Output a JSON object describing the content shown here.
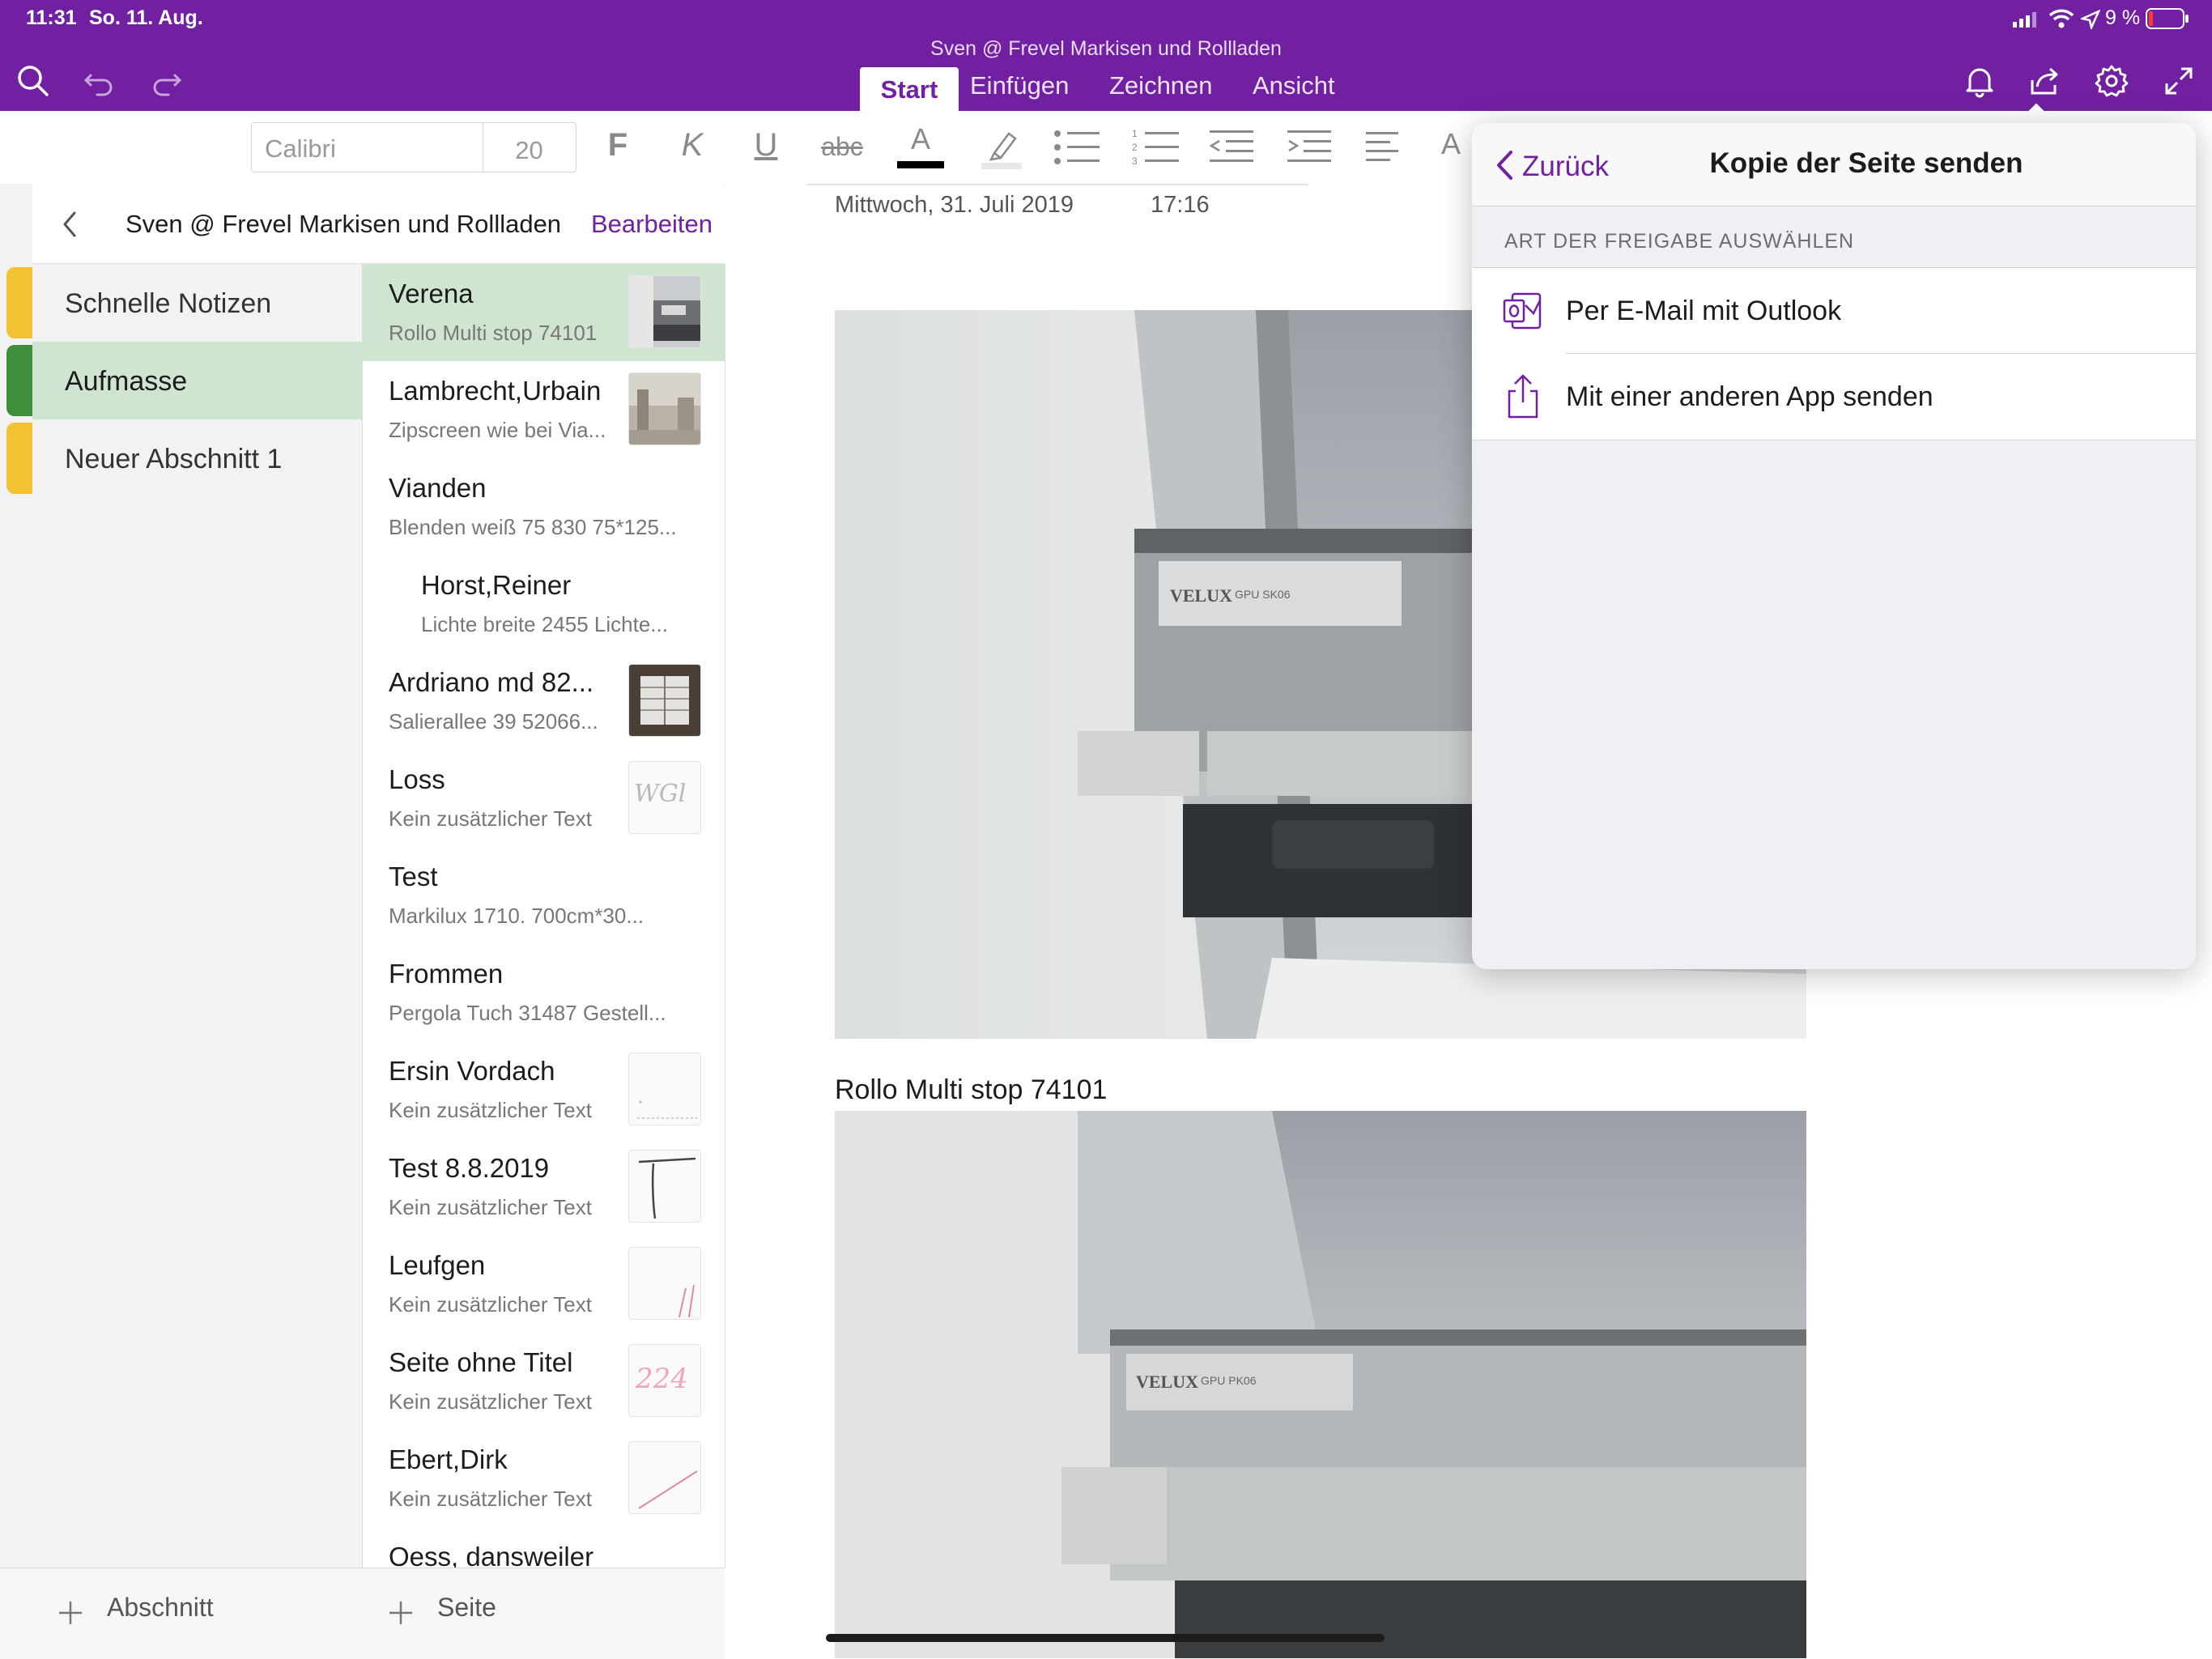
{
  "status": {
    "time": "11:31",
    "date": "So. 11. Aug.",
    "battery": "9 %"
  },
  "notebook_name": "Sven @ Frevel Markisen und Rollladen",
  "tabs": [
    {
      "label": "Start",
      "active": true
    },
    {
      "label": "Einfügen"
    },
    {
      "label": "Zeichnen"
    },
    {
      "label": "Ansicht"
    }
  ],
  "ribbon": {
    "font_name": "Calibri",
    "font_size": "20",
    "bold": "F",
    "italic": "K",
    "underline": "U",
    "strike": "abc",
    "font_color": "A",
    "style": "A"
  },
  "nav": {
    "title": "Sven @ Frevel Markisen und Rollladen",
    "edit": "Bearbeiten"
  },
  "sections": [
    {
      "label": "Schnelle Notizen",
      "color": "#f2c232"
    },
    {
      "label": "Aufmasse",
      "color": "#3f8f3a",
      "selected": true
    },
    {
      "label": "Neuer Abschnitt 1",
      "color": "#f2c232"
    }
  ],
  "pages": [
    {
      "title": "Verena",
      "sub": "Rollo Multi stop 74101",
      "selected": true,
      "thumb": "photo"
    },
    {
      "title": "Lambrecht,Urbain",
      "sub": "Zipscreen wie bei Via...",
      "thumb": "photo"
    },
    {
      "title": "Vianden",
      "sub": "Blenden weiß 75 830  75*125..."
    },
    {
      "title": "Horst,Reiner",
      "sub": "Lichte breite  2455  Lichte...",
      "subpage": true
    },
    {
      "title": "Ardriano md 82...",
      "sub": "Salierallee 39  52066...",
      "thumb": "photo"
    },
    {
      "title": "Loss",
      "sub": "Kein zusätzlicher Text",
      "thumb": "ink",
      "thumb_text": "WGl"
    },
    {
      "title": "Test",
      "sub": "Markilux 1710.          700cm*30..."
    },
    {
      "title": "Frommen",
      "sub": "Pergola  Tuch 31487  Gestell..."
    },
    {
      "title": "Ersin Vordach",
      "sub": "Kein zusätzlicher Text",
      "thumb": "ink"
    },
    {
      "title": "Test 8.8.2019",
      "sub": "Kein zusätzlicher Text",
      "thumb": "ink"
    },
    {
      "title": "Leufgen",
      "sub": "Kein zusätzlicher Text",
      "thumb": "ink"
    },
    {
      "title": "Seite ohne Titel",
      "sub": "Kein zusätzlicher Text",
      "thumb": "ink",
      "thumb_text": "224"
    },
    {
      "title": "Ebert,Dirk",
      "sub": "Kein zusätzlicher Text",
      "thumb": "ink"
    },
    {
      "title": "Oess, dansweiler",
      "sub": ""
    }
  ],
  "bottom": {
    "add_section": "Abschnitt",
    "add_page": "Seite"
  },
  "note": {
    "date": "Mittwoch, 31. Juli 2019",
    "time": "17:16",
    "caption": "Rollo Multi stop 74101",
    "label_brand": "VELUX",
    "label_model_1": "GPU SK06",
    "label_model_2": "GPU PK06"
  },
  "popover": {
    "back": "Zurück",
    "title": "Kopie der Seite senden",
    "section_header": "ART DER FREIGABE AUSWÄHLEN",
    "options": [
      {
        "label": "Per E-Mail mit Outlook",
        "icon": "outlook-icon"
      },
      {
        "label": "Mit einer anderen App senden",
        "icon": "share-icon"
      }
    ]
  },
  "colors": {
    "brand": "#7120a1",
    "selected_bg": "#cfe5d1"
  }
}
